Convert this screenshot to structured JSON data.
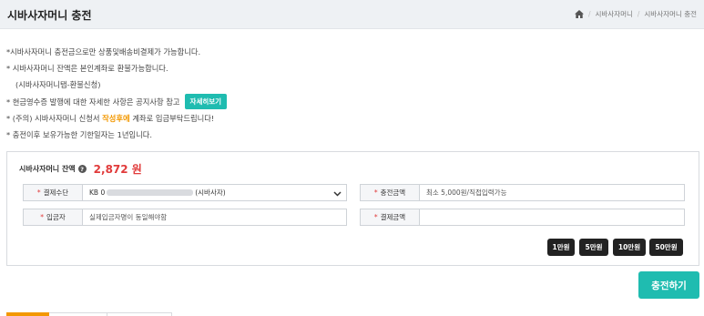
{
  "header": {
    "title": "시바사자머니 충전",
    "breadcrumb": [
      "시바사자머니",
      "시바사자머니 충전"
    ]
  },
  "notices": {
    "line1": "*시바사자머니 충전금으로만 상품및배송비결제가 가능합니다.",
    "line2": "* 시바사자머니 잔액은 본인계좌로 환불가능합니다.",
    "line3": "(시바사자머니탭-환불신청)",
    "line4": "* 현금영수증 발행에 대한 자세한 사항은 공지사항 참고",
    "detail_button": "자세히보기",
    "line5_pre": "* (주의) 시바사자머니 신청서 ",
    "line5_hl": "작성후에",
    "line5_post": " 계좌로 입금부탁드립니다!",
    "line6": "* 충전이후 보유가능한 기한일자는 1년입니다."
  },
  "balance": {
    "label": "시바사자머니 잔액",
    "help": "?",
    "amount": "2,872 원"
  },
  "form": {
    "required_mark": "*",
    "payment_method_label": "결제수단",
    "payment_method_prefix": "KB 0",
    "payment_method_suffix": "(시바사자)",
    "charge_amount_label": "충전금액",
    "charge_amount_placeholder": "최소 5,000원/직접입력가능",
    "depositor_label": "입금자",
    "depositor_placeholder": "실제입금자명이 동일해야함",
    "payment_amount_label": "결제금액",
    "payment_amount_value": ""
  },
  "amount_buttons": [
    "1만원",
    "5만원",
    "10만원",
    "50만원"
  ],
  "charge_button": "충전하기",
  "colors": {
    "accent": "#1fbcb0",
    "highlight": "#f39800",
    "balance": "#e13b3b"
  }
}
